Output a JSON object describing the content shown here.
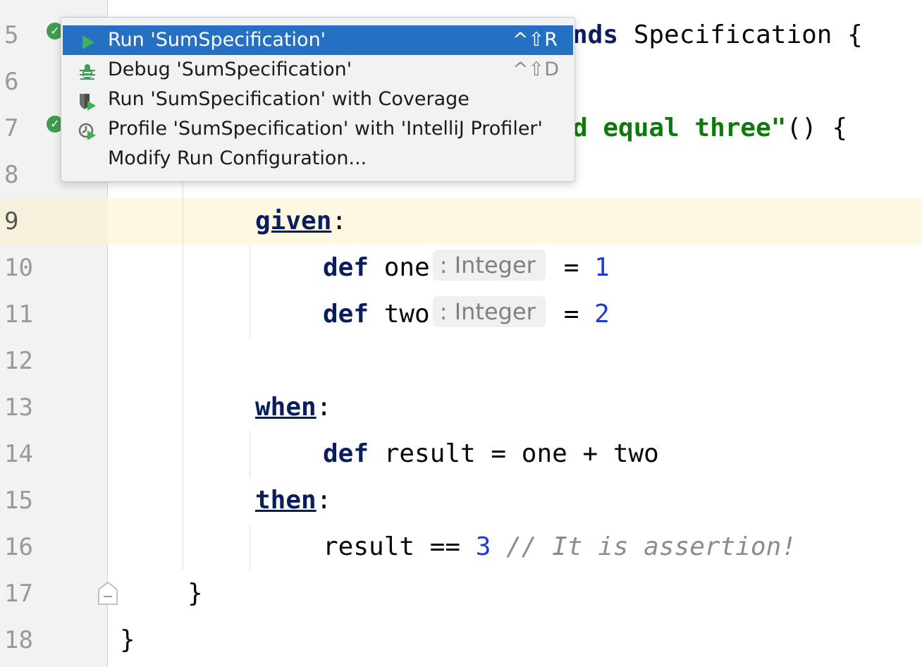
{
  "editor": {
    "lines": [
      {
        "num": "5"
      },
      {
        "num": "6"
      },
      {
        "num": "7"
      },
      {
        "num": "8"
      },
      {
        "num": "9"
      },
      {
        "num": "10"
      },
      {
        "num": "11"
      },
      {
        "num": "12"
      },
      {
        "num": "13"
      },
      {
        "num": "14"
      },
      {
        "num": "15"
      },
      {
        "num": "16"
      },
      {
        "num": "17"
      },
      {
        "num": "18"
      }
    ],
    "current_line": "9",
    "code": {
      "l5_kw": "nds",
      "l5_rest": " Specification {",
      "l7_str": "d equal three\"",
      "l7_rest": "() {",
      "l9_label": "given",
      "l9_colon": ":",
      "l10_kw": "def",
      "l10_name": " one",
      "l10_hint": ": Integer",
      "l10_eq": "= ",
      "l10_val": "1",
      "l11_kw": "def",
      "l11_name": " two",
      "l11_hint": ": Integer",
      "l11_eq": "= ",
      "l11_val": "2",
      "l13_label": "when",
      "l13_colon": ":",
      "l14_kw": "def",
      "l14_rest": " result = one + two",
      "l15_label": "then",
      "l15_colon": ":",
      "l16_expr": "result == ",
      "l16_val": "3",
      "l16_comment": " // It is assertion!",
      "l17": "}",
      "l18": "}"
    }
  },
  "popup": {
    "items": [
      {
        "label": "Run 'SumSpecification'",
        "shortcut": "^⇧R",
        "icon": "run-icon"
      },
      {
        "label": "Debug 'SumSpecification'",
        "shortcut": "^⇧D",
        "icon": "debug-icon"
      },
      {
        "label": "Run 'SumSpecification' with Coverage",
        "shortcut": "",
        "icon": "coverage-icon"
      },
      {
        "label": "Profile 'SumSpecification' with 'IntelliJ Profiler'",
        "shortcut": "",
        "icon": "profiler-icon"
      },
      {
        "label": "Modify Run Configuration...",
        "shortcut": "",
        "icon": ""
      }
    ]
  },
  "colors": {
    "selection": "#2570c2",
    "run_green": "#3d9e50",
    "current_line_bg": "#fdf8e1",
    "keyword": "#0a1d5c",
    "number": "#1b3bd6",
    "string": "#0e7a0e",
    "comment": "#8c8c8c"
  }
}
